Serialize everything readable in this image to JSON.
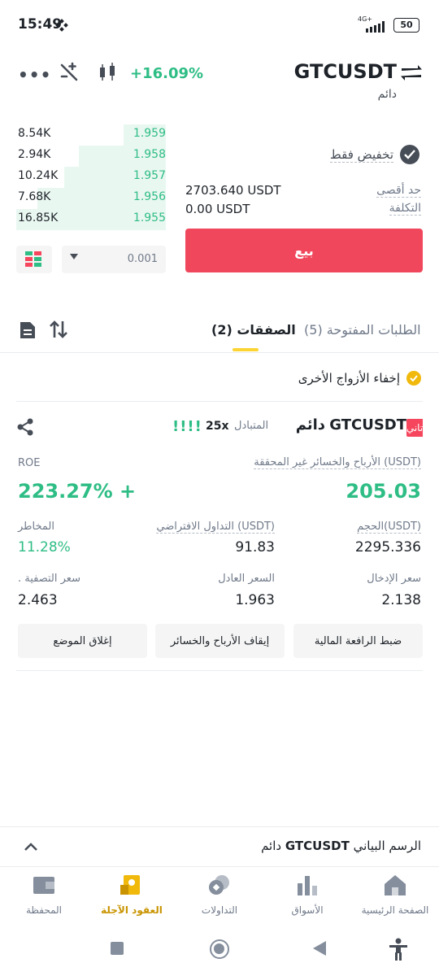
{
  "status": {
    "time": "15:49",
    "battery": "50",
    "network": "4G+"
  },
  "header": {
    "change": "+16.09%",
    "symbol": "GTCUSDT",
    "contract_type": "دائم"
  },
  "order_book": {
    "rows": [
      {
        "amount": "8.54K",
        "price": "1.959",
        "depth": 0.28
      },
      {
        "amount": "2.94K",
        "price": "1.958",
        "depth": 0.58
      },
      {
        "amount": "10.24K",
        "price": "1.957",
        "depth": 0.68
      },
      {
        "amount": "7.68K",
        "price": "1.956",
        "depth": 0.86
      },
      {
        "amount": "16.85K",
        "price": "1.955",
        "depth": 1.0
      }
    ],
    "precision": "0.001"
  },
  "form": {
    "reduce_only_label": "تخفيض فقط",
    "max_label": "حد أقصى",
    "max_value": "2703.640 USDT",
    "cost_label": "التكلفة",
    "cost_value": "0.00 USDT",
    "sell_label": "بيع"
  },
  "tabs": {
    "open_orders": "الطلبات المفتوحة (5)",
    "positions": "الصفقات (2)"
  },
  "hide_other_pairs": "إخفاء الأزواج الأخرى",
  "position": {
    "badge": "تاني",
    "symbol": "GTCUSDT",
    "type": "دائم",
    "margin_mode": "المتبادل",
    "leverage": "25x",
    "risk_bars": "!!!!",
    "unrealized_pnl_label": "الأرباح والخسائر غير المحققة (USDT)",
    "unrealized_pnl": "205.03",
    "roe_label": "ROE",
    "roe": "+ 223.27%",
    "size_label": "الحجم(USDT)",
    "size": "2295.336",
    "notional_label": "التداول الافتراضي (USDT)",
    "notional": "91.83",
    "risk_label": "المخاطر",
    "risk": "11.28%",
    "entry_label": "سعر الإدخال",
    "entry": "2.138",
    "mark_label": "السعر العادل",
    "mark": "1.963",
    "liq_label": "سعر التصفية .",
    "liq": "2.463",
    "btn_leverage": "ضبط الرافعة المالية",
    "btn_tpsl": "إيقاف الأرباح والخسائر",
    "btn_close": "إغلاق الموضع"
  },
  "chart_bar": {
    "label": "الرسم البياني",
    "symbol": "GTCUSDT",
    "type": "دائم"
  },
  "nav": [
    {
      "label": "الصفحة الرئيسية",
      "icon": "home-icon"
    },
    {
      "label": "الأسواق",
      "icon": "markets-icon"
    },
    {
      "label": "التداولات",
      "icon": "trades-icon"
    },
    {
      "label": "العقود الآجلة",
      "icon": "futures-icon"
    },
    {
      "label": "المحفظة",
      "icon": "wallet-icon"
    }
  ],
  "colors": {
    "green": "#2ebd85",
    "red": "#f6465d",
    "accent": "#f0b90b"
  }
}
